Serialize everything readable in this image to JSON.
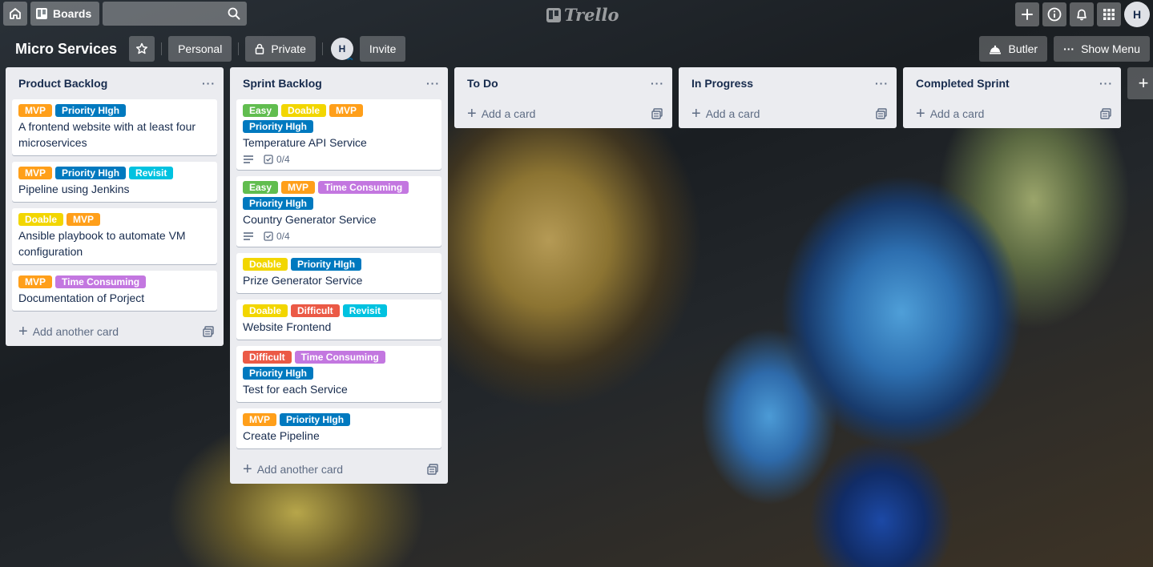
{
  "header": {
    "boards_label": "Boards",
    "search_placeholder": "",
    "logo_text": "Trello",
    "avatar_initial": "H"
  },
  "board": {
    "title": "Micro Services",
    "team_label": "Personal",
    "visibility_label": "Private",
    "member_initial": "H",
    "invite_label": "Invite",
    "butler_label": "Butler",
    "show_menu_label": "Show Menu"
  },
  "colors": {
    "green": "#61bd4f",
    "yellow": "#f2d600",
    "orange": "#ff9f1a",
    "red": "#eb5a46",
    "purple": "#c377e0",
    "blue": "#0079bf",
    "sky": "#00c2e0"
  },
  "lists": [
    {
      "title": "Product Backlog",
      "add_label": "Add another card",
      "cards": [
        {
          "labels": [
            {
              "text": "MVP",
              "color": "orange"
            },
            {
              "text": "Priority HIgh",
              "color": "blue"
            }
          ],
          "title": "A frontend website with at least four microservices"
        },
        {
          "labels": [
            {
              "text": "MVP",
              "color": "orange"
            },
            {
              "text": "Priority HIgh",
              "color": "blue"
            },
            {
              "text": "Revisit",
              "color": "sky"
            }
          ],
          "title": "Pipeline using Jenkins"
        },
        {
          "labels": [
            {
              "text": "Doable",
              "color": "yellow"
            },
            {
              "text": "MVP",
              "color": "orange"
            }
          ],
          "title": "Ansible playbook to automate VM configuration"
        },
        {
          "labels": [
            {
              "text": "MVP",
              "color": "orange"
            },
            {
              "text": "Time Consuming",
              "color": "purple"
            }
          ],
          "title": "Documentation of Porject"
        }
      ]
    },
    {
      "title": "Sprint Backlog",
      "add_label": "Add another card",
      "cards": [
        {
          "labels": [
            {
              "text": "Easy",
              "color": "green"
            },
            {
              "text": "Doable",
              "color": "yellow"
            },
            {
              "text": "MVP",
              "color": "orange"
            },
            {
              "text": "Priority HIgh",
              "color": "blue"
            }
          ],
          "title": "Temperature API Service",
          "checklist": "0/4"
        },
        {
          "labels": [
            {
              "text": "Easy",
              "color": "green"
            },
            {
              "text": "MVP",
              "color": "orange"
            },
            {
              "text": "Time Consuming",
              "color": "purple"
            },
            {
              "text": "Priority HIgh",
              "color": "blue"
            }
          ],
          "title": "Country Generator Service",
          "checklist": "0/4"
        },
        {
          "labels": [
            {
              "text": "Doable",
              "color": "yellow"
            },
            {
              "text": "Priority HIgh",
              "color": "blue"
            }
          ],
          "title": "Prize Generator Service"
        },
        {
          "labels": [
            {
              "text": "Doable",
              "color": "yellow"
            },
            {
              "text": "Difficult",
              "color": "red"
            },
            {
              "text": "Revisit",
              "color": "sky"
            }
          ],
          "title": "Website Frontend"
        },
        {
          "labels": [
            {
              "text": "Difficult",
              "color": "red"
            },
            {
              "text": "Time Consuming",
              "color": "purple"
            },
            {
              "text": "Priority HIgh",
              "color": "blue"
            }
          ],
          "title": "Test for each Service"
        },
        {
          "labels": [
            {
              "text": "MVP",
              "color": "orange"
            },
            {
              "text": "Priority HIgh",
              "color": "blue"
            }
          ],
          "title": "Create Pipeline"
        }
      ]
    },
    {
      "title": "To Do",
      "add_label": "Add a card",
      "cards": []
    },
    {
      "title": "In Progress",
      "add_label": "Add a card",
      "cards": []
    },
    {
      "title": "Completed Sprint",
      "add_label": "Add a card",
      "cards": []
    }
  ]
}
